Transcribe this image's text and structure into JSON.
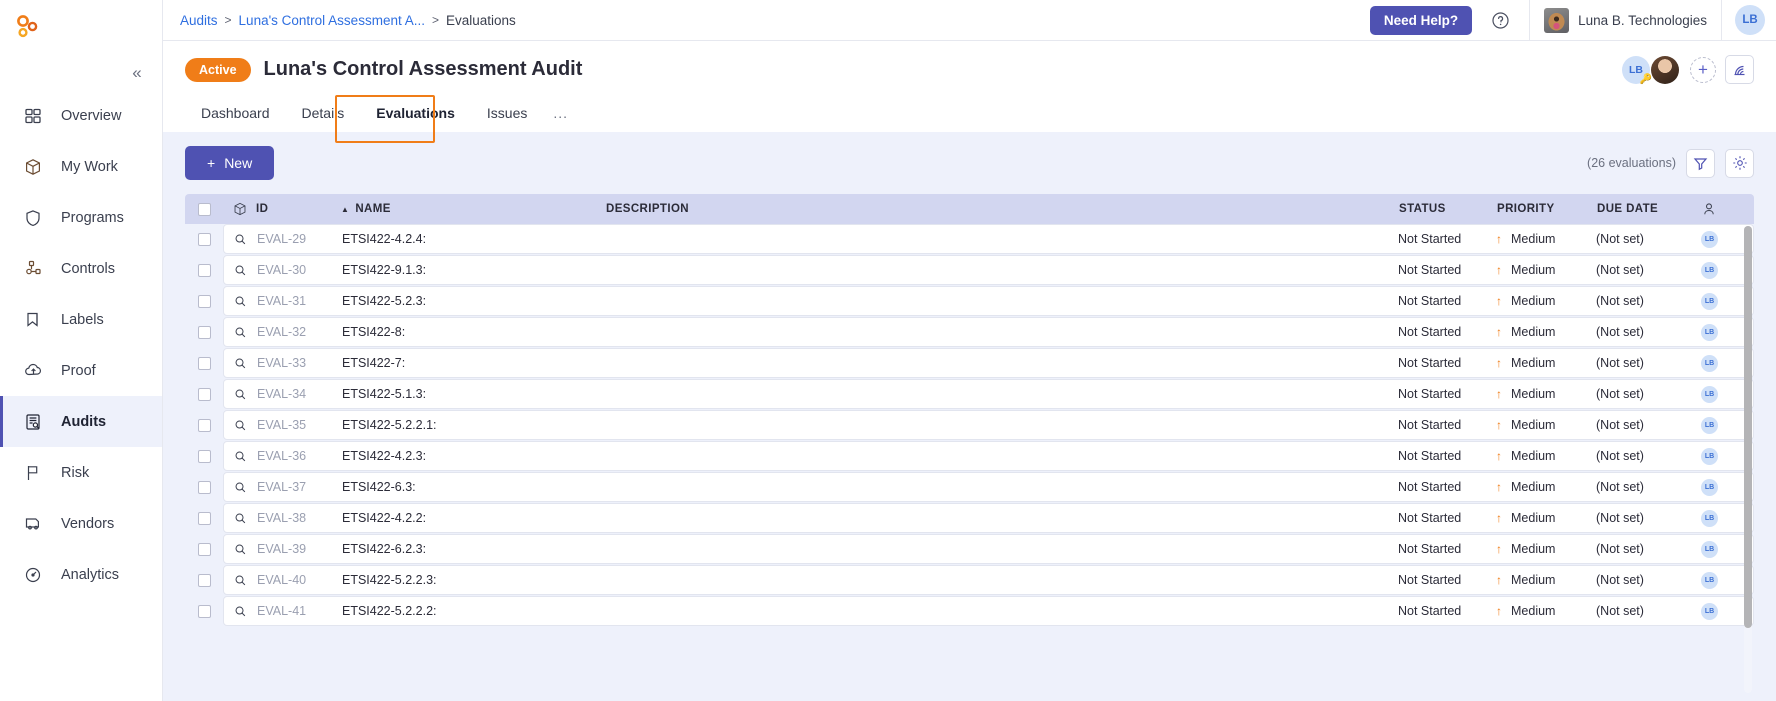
{
  "sidebar": {
    "logo": "logo-icon",
    "collapse_label": "«",
    "items": [
      {
        "label": "Overview",
        "icon": "grid-icon",
        "active": false
      },
      {
        "label": "My Work",
        "icon": "box-icon",
        "active": false
      },
      {
        "label": "Programs",
        "icon": "shield-icon",
        "active": false
      },
      {
        "label": "Controls",
        "icon": "nodes-icon",
        "active": false
      },
      {
        "label": "Labels",
        "icon": "bookmark-icon",
        "active": false
      },
      {
        "label": "Proof",
        "icon": "cloud-up-icon",
        "active": false
      },
      {
        "label": "Audits",
        "icon": "audit-icon",
        "active": true
      },
      {
        "label": "Risk",
        "icon": "flag-icon",
        "active": false
      },
      {
        "label": "Vendors",
        "icon": "truck-icon",
        "active": false
      },
      {
        "label": "Analytics",
        "icon": "gauge-icon",
        "active": false
      }
    ]
  },
  "topbar": {
    "breadcrumb": [
      {
        "text": "Audits",
        "link": true
      },
      {
        "text": "Luna's Control Assessment A...",
        "link": true
      },
      {
        "text": "Evaluations",
        "link": false
      }
    ],
    "separator": ">",
    "need_help_label": "Need Help?",
    "help_icon": "question-circle-icon",
    "org_name": "Luna B. Technologies",
    "org_avatar": "org-photo-avatar",
    "user_initials": "LB"
  },
  "page": {
    "status_badge": "Active",
    "title": "Luna's Control Assessment Audit",
    "avatars": [
      {
        "initials": "LB",
        "type": "initials",
        "badge": "key-icon"
      },
      {
        "initials": "",
        "type": "photo",
        "badge": ""
      }
    ],
    "add_member_label": "+",
    "feed_icon": "rss-feed-icon",
    "tabs": [
      {
        "label": "Dashboard",
        "selected": false
      },
      {
        "label": "Details",
        "selected": false
      },
      {
        "label": "Evaluations",
        "selected": true
      },
      {
        "label": "Issues",
        "selected": false
      },
      {
        "label": "...",
        "selected": false
      }
    ]
  },
  "toolbar": {
    "new_label": "New",
    "new_plus": "+",
    "count_label": "(26 evaluations)",
    "filter_icon": "filter-funnel-icon",
    "settings_icon": "gear-icon"
  },
  "table": {
    "columns": {
      "select": "",
      "type_icon": "box-icon",
      "id": "ID",
      "sort_indicator": "▲",
      "name": "NAME",
      "description": "DESCRIPTION",
      "status": "STATUS",
      "priority": "PRIORITY",
      "due_date": "DUE DATE",
      "assignee_icon": "person-icon"
    },
    "rows": [
      {
        "id": "EVAL-29",
        "name": "ETSI422-4.2.4:",
        "description": "",
        "status": "Not Started",
        "priority": "Medium",
        "due_date": "(Not set)",
        "assignee": "LB"
      },
      {
        "id": "EVAL-30",
        "name": "ETSI422-9.1.3:",
        "description": "",
        "status": "Not Started",
        "priority": "Medium",
        "due_date": "(Not set)",
        "assignee": "LB"
      },
      {
        "id": "EVAL-31",
        "name": "ETSI422-5.2.3:",
        "description": "",
        "status": "Not Started",
        "priority": "Medium",
        "due_date": "(Not set)",
        "assignee": "LB"
      },
      {
        "id": "EVAL-32",
        "name": "ETSI422-8:",
        "description": "",
        "status": "Not Started",
        "priority": "Medium",
        "due_date": "(Not set)",
        "assignee": "LB"
      },
      {
        "id": "EVAL-33",
        "name": "ETSI422-7:",
        "description": "",
        "status": "Not Started",
        "priority": "Medium",
        "due_date": "(Not set)",
        "assignee": "LB"
      },
      {
        "id": "EVAL-34",
        "name": "ETSI422-5.1.3:",
        "description": "",
        "status": "Not Started",
        "priority": "Medium",
        "due_date": "(Not set)",
        "assignee": "LB"
      },
      {
        "id": "EVAL-35",
        "name": "ETSI422-5.2.2.1:",
        "description": "",
        "status": "Not Started",
        "priority": "Medium",
        "due_date": "(Not set)",
        "assignee": "LB"
      },
      {
        "id": "EVAL-36",
        "name": "ETSI422-4.2.3:",
        "description": "",
        "status": "Not Started",
        "priority": "Medium",
        "due_date": "(Not set)",
        "assignee": "LB"
      },
      {
        "id": "EVAL-37",
        "name": "ETSI422-6.3:",
        "description": "",
        "status": "Not Started",
        "priority": "Medium",
        "due_date": "(Not set)",
        "assignee": "LB"
      },
      {
        "id": "EVAL-38",
        "name": "ETSI422-4.2.2:",
        "description": "",
        "status": "Not Started",
        "priority": "Medium",
        "due_date": "(Not set)",
        "assignee": "LB"
      },
      {
        "id": "EVAL-39",
        "name": "ETSI422-6.2.3:",
        "description": "",
        "status": "Not Started",
        "priority": "Medium",
        "due_date": "(Not set)",
        "assignee": "LB"
      },
      {
        "id": "EVAL-40",
        "name": "ETSI422-5.2.2.3:",
        "description": "",
        "status": "Not Started",
        "priority": "Medium",
        "due_date": "(Not set)",
        "assignee": "LB"
      },
      {
        "id": "EVAL-41",
        "name": "ETSI422-5.2.2.2:",
        "description": "",
        "status": "Not Started",
        "priority": "Medium",
        "due_date": "(Not set)",
        "assignee": "LB"
      }
    ]
  },
  "colors": {
    "brand_purple": "#4f52b2",
    "accent_orange": "#f07d18",
    "link_blue": "#2f6fe0",
    "content_bg": "#eef1fb",
    "table_header_bg": "#d2d6f0"
  }
}
